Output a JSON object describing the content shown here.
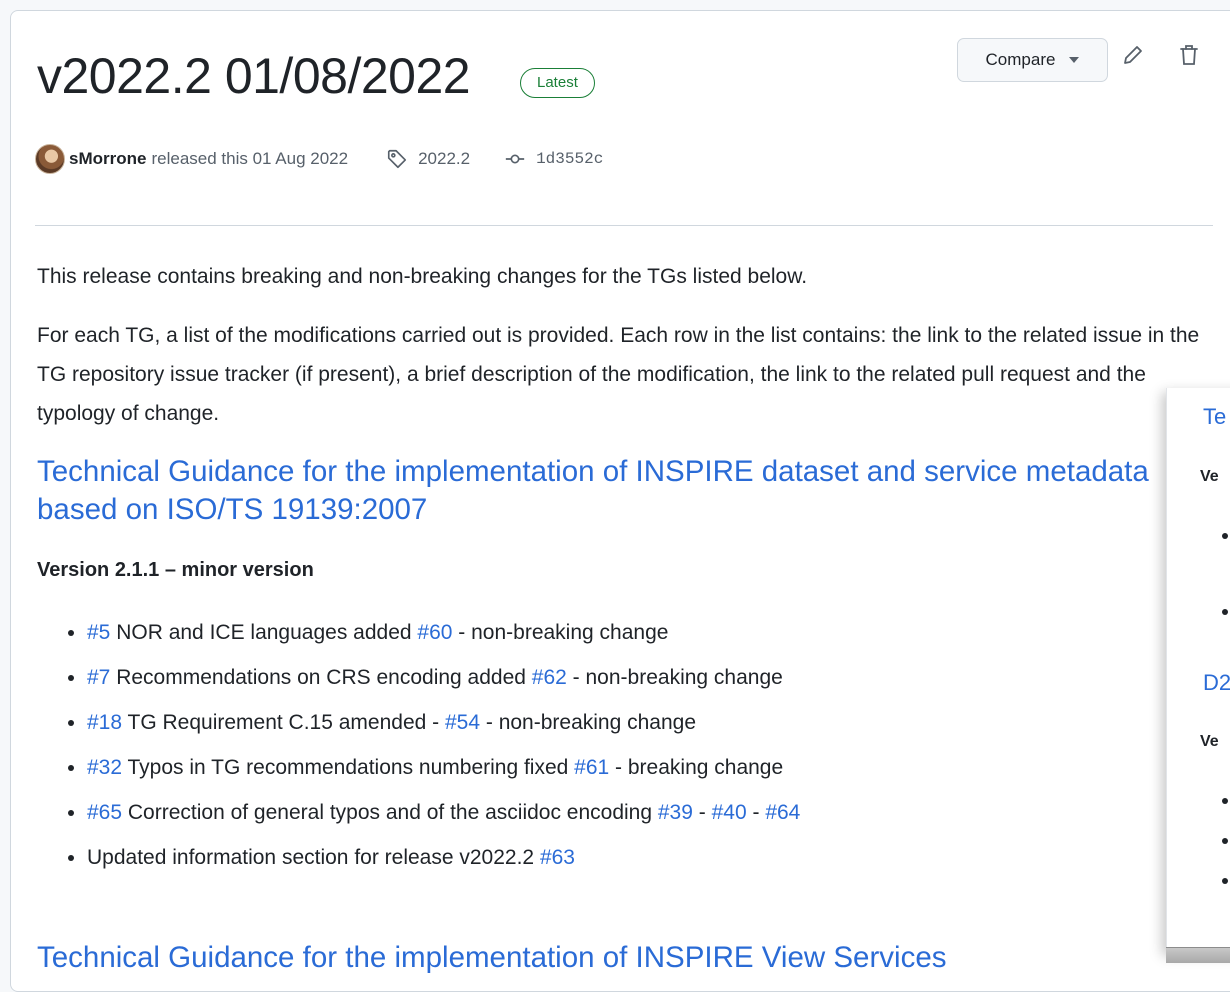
{
  "release": {
    "title": "v2022.2 01/08/2022",
    "badge": "Latest",
    "compare_label": "Compare",
    "author": "sMorrone",
    "released_text": "released this 01 Aug 2022",
    "tag": "2022.2",
    "commit": "1d3552c"
  },
  "body": {
    "intro": "This release contains breaking and non-breaking changes for the TGs listed below.",
    "paragraph": "For each TG, a list of the modifications carried out is provided. Each row in the list contains: the link to the related issue in the TG repository issue tracker (if present), a brief description of the modification, the link to the related pull request and the typology of change.",
    "section1": {
      "heading": "Technical Guidance for the implementation of INSPIRE dataset and service metadata based on ISO/TS 19139:2007",
      "version": "Version 2.1.1 – minor version",
      "items": [
        {
          "issue": "#5",
          "text": " NOR and ICE languages added ",
          "pr": "#60",
          "tail": " - non-breaking change"
        },
        {
          "issue": "#7",
          "text": " Recommendations on CRS encoding added ",
          "pr": "#62",
          "tail": " - non-breaking change"
        },
        {
          "issue": "#18",
          "text": " TG Requirement C.15 amended - ",
          "pr": "#54",
          "tail": " - non-breaking change"
        },
        {
          "issue": "#32",
          "text": " Typos in TG recommendations numbering fixed ",
          "pr": "#61",
          "tail": " - breaking change"
        },
        {
          "issue": "#65",
          "text": " Correction of general typos and of the asciidoc encoding ",
          "pr": "#39",
          "sep1": " - ",
          "pr2": "#40",
          "sep2": " - ",
          "pr3": "#64"
        },
        {
          "text": "Updated information section for release v2022.2 ",
          "pr": "#63"
        }
      ]
    },
    "section2_heading": "Technical Guidance for the implementation of INSPIRE View Services"
  },
  "popup": {
    "h1": "Te",
    "v1": "Ve",
    "h2": "D2",
    "v2": "Ve"
  },
  "colors": {
    "link": "#2a6bd6",
    "latest_badge": "#1a7f37",
    "border": "#d0d7de"
  },
  "icons": [
    "pencil-icon",
    "trash-icon",
    "tag-icon",
    "git-commit-icon",
    "caret-down-icon"
  ]
}
